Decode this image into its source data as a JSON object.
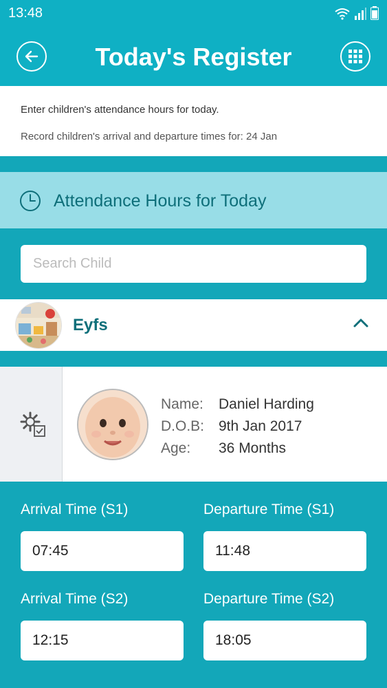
{
  "status": {
    "time": "13:48"
  },
  "header": {
    "title": "Today's Register"
  },
  "info": {
    "line1": "Enter children's attendance hours for today.",
    "line2": "Record children's arrival and departure times for: 24 Jan"
  },
  "section": {
    "title": "Attendance Hours for Today"
  },
  "search": {
    "placeholder": "Search Child"
  },
  "group": {
    "name": "Eyfs"
  },
  "child": {
    "name_label": "Name:",
    "name": "Daniel Harding",
    "dob_label": "D.O.B:",
    "dob": "9th Jan 2017",
    "age_label": "Age:",
    "age": "36 Months"
  },
  "times": {
    "arrival_s1_label": "Arrival Time (S1)",
    "arrival_s1": "07:45",
    "departure_s1_label": "Departure Time (S1)",
    "departure_s1": "11:48",
    "arrival_s2_label": "Arrival Time (S2)",
    "arrival_s2": "12:15",
    "departure_s2_label": "Departure Time (S2)",
    "departure_s2": "18:05"
  },
  "colors": {
    "primary": "#13a7b9",
    "section_bg": "#98dde7",
    "title_text": "#0e6f7a"
  },
  "icons": [
    "back-arrow-icon",
    "grid-menu-icon",
    "clock-icon",
    "chevron-up-icon",
    "settings-gear-icon"
  ]
}
